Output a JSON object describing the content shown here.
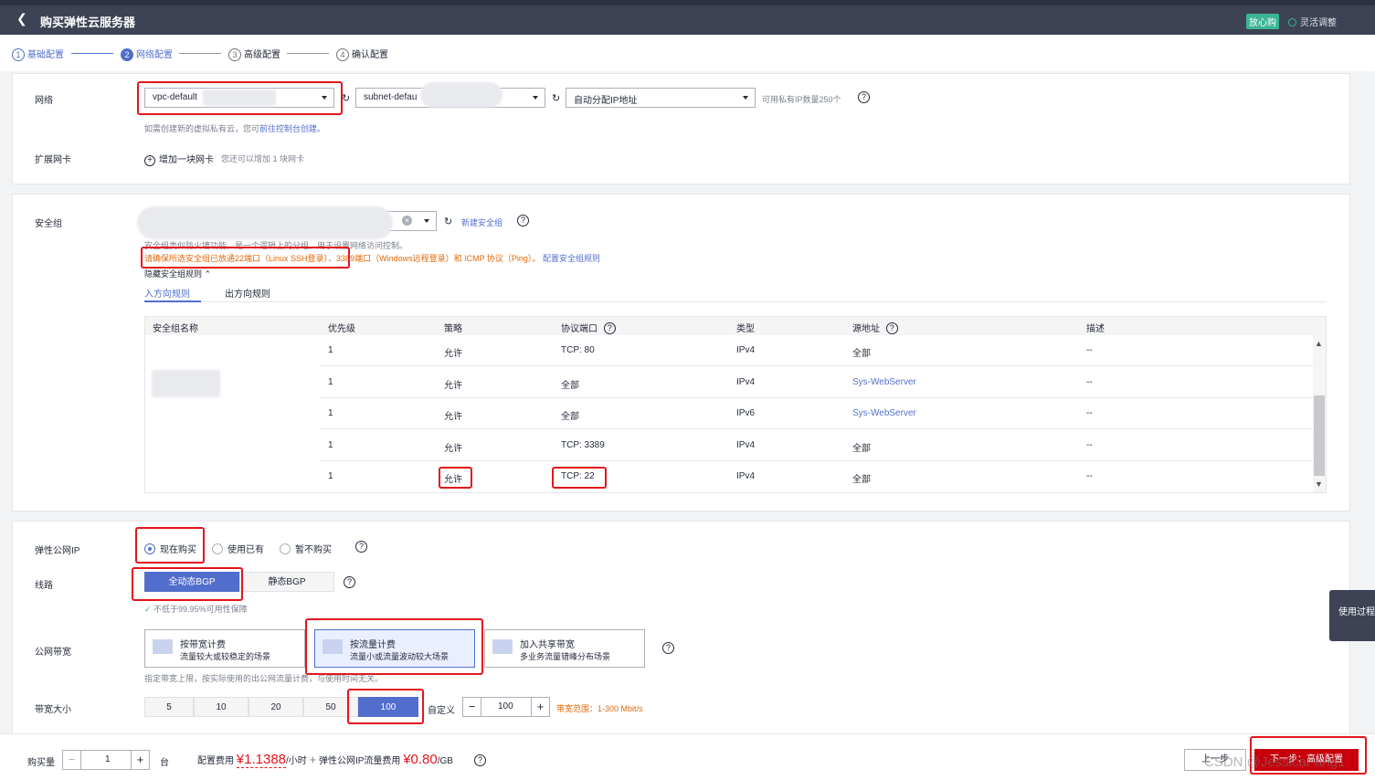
{
  "header": {
    "back_icon": "chevron-left-icon",
    "title": "购买弹性云服务器",
    "badge": "放心购",
    "flex_label": "灵活调整"
  },
  "steps": [
    {
      "num": "1",
      "label": "基础配置"
    },
    {
      "num": "2",
      "label": "网络配置"
    },
    {
      "num": "3",
      "label": "高级配置"
    },
    {
      "num": "4",
      "label": "确认配置"
    }
  ],
  "network": {
    "label": "网络",
    "vpc_value": "vpc-default",
    "subnet_value": "subnet-defau",
    "ip_value": "自动分配IP地址",
    "ip_count": "可用私有IP数量250个",
    "hint_prefix": "如需创建新的虚拟私有云，您可",
    "hint_link": "前往控制台创建。",
    "nic_label": "扩展网卡",
    "add_nic": "增加一块网卡",
    "add_nic_hint": "您还可以增加 1 块网卡"
  },
  "security": {
    "label": "安全组",
    "new_link": "新建安全组",
    "desc": "安全组类似防火墙功能，是一个逻辑上的分组，用于设置网络访问控制。",
    "warn_part1": "请确保所选安全组已放通22端口（Linux SSH登录）",
    "warn_part2": "、3389端口（Windows远程登录）和 ICMP 协议（Ping）。",
    "warn_link": "配置安全组规则",
    "toggle": "隐藏安全组规则",
    "tabs": [
      "入方向规则",
      "出方向规则"
    ],
    "columns": [
      "安全组名称",
      "优先级",
      "策略",
      "协议端口",
      "类型",
      "源地址",
      "描述"
    ],
    "rows": [
      {
        "priority": "1",
        "policy": "允许",
        "port": "TCP: 80",
        "type": "IPv4",
        "source": "全部",
        "desc": "--"
      },
      {
        "priority": "1",
        "policy": "允许",
        "port": "全部",
        "type": "IPv4",
        "source": "Sys-WebServer",
        "desc": "--"
      },
      {
        "priority": "1",
        "policy": "允许",
        "port": "全部",
        "type": "IPv6",
        "source": "Sys-WebServer",
        "desc": "--"
      },
      {
        "priority": "1",
        "policy": "允许",
        "port": "TCP: 3389",
        "type": "IPv4",
        "source": "全部",
        "desc": "--"
      },
      {
        "priority": "1",
        "policy": "允许",
        "port": "TCP: 22",
        "type": "IPv4",
        "source": "全部",
        "desc": "--"
      }
    ]
  },
  "eip": {
    "label": "弹性公网IP",
    "options": [
      "现在购买",
      "使用已有",
      "暂不购买"
    ],
    "line_label": "线路",
    "lines": [
      "全动态BGP",
      "静态BGP"
    ],
    "sla": "不低于99.95%可用性保障",
    "bw_label": "公网带宽",
    "billing": [
      {
        "title": "按带宽计费",
        "desc": "流量较大或较稳定的场景"
      },
      {
        "title": "按流量计费",
        "desc": "流量小或流量波动较大场景"
      },
      {
        "title": "加入共享带宽",
        "desc": "多业务流量错峰分布场景"
      }
    ],
    "billing_hint": "指定带宽上限，按实际使用的出公网流量计费，与使用时间无关。",
    "size_label": "带宽大小",
    "sizes": [
      "5",
      "10",
      "20",
      "50",
      "100"
    ],
    "custom_label": "自定义",
    "custom_value": "100",
    "range_label": "带宽范围：",
    "range_value": "1-300 Mbit/s"
  },
  "footer": {
    "qty_label": "购买量",
    "qty_value": "1",
    "qty_unit": "台",
    "fee_label": "配置费用",
    "fee_value": "¥1.1388",
    "fee_unit": "/小时",
    "plus": "+",
    "eip_fee_label": "弹性公网IP流量费用",
    "eip_fee_value": "¥0.80",
    "eip_fee_unit": "/GB",
    "prev": "上一步",
    "next": "下一步：高级配置"
  },
  "side_tab": "使用过程",
  "watermark": "CSDN @JessicaFang1",
  "colors": {
    "accent": "#526ecc",
    "danger": "#c7000b",
    "warn": "#e36a0b"
  }
}
